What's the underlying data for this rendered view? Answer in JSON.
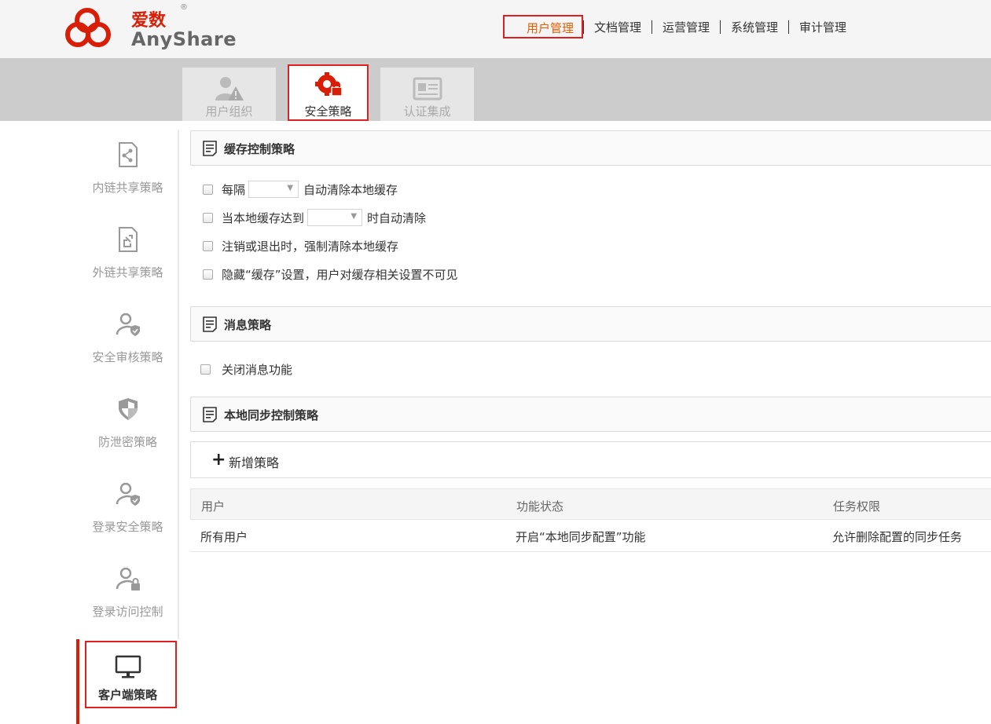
{
  "header": {
    "logo_cn": "爱数",
    "logo_reg": "®",
    "logo_en": "AnyShare",
    "nav": [
      {
        "label": "用户管理"
      },
      {
        "label": "文档管理"
      },
      {
        "label": "运营管理"
      },
      {
        "label": "系统管理"
      },
      {
        "label": "审计管理"
      }
    ],
    "brand_color": "#d81e06",
    "active_color": "#e65c00"
  },
  "subtabs": [
    {
      "label": "用户组织",
      "icon": "user-warning-icon"
    },
    {
      "label": "安全策略",
      "icon": "gear-lock-icon"
    },
    {
      "label": "认证集成",
      "icon": "id-card-icon"
    }
  ],
  "sidebar": {
    "items": [
      {
        "label": "内链共享策略",
        "icon": "internal-share-icon"
      },
      {
        "label": "外链共享策略",
        "icon": "external-share-icon"
      },
      {
        "label": "安全审核策略",
        "icon": "user-shield-icon"
      },
      {
        "label": "防泄密策略",
        "icon": "shield-icon"
      },
      {
        "label": "登录安全策略",
        "icon": "user-shield-icon"
      },
      {
        "label": "登录访问控制",
        "icon": "user-lock-icon"
      },
      {
        "label": "客户端策略",
        "icon": "monitor-icon"
      }
    ]
  },
  "cache_policy": {
    "title": "缓存控制策略",
    "opt1_prefix": "每隔",
    "opt1_select": "",
    "opt1_suffix": "自动清除本地缓存",
    "opt2_prefix": "当本地缓存达到",
    "opt2_select": "",
    "opt2_suffix": "时自动清除",
    "opt3": "注销或退出时，强制清除本地缓存",
    "opt4": "隐藏“缓存”设置，用户对缓存相关设置不可见"
  },
  "message_policy": {
    "title": "消息策略",
    "opt1": "关闭消息功能"
  },
  "sync_policy": {
    "title": "本地同步控制策略",
    "add_label": "新增策略",
    "columns": [
      "用户",
      "功能状态",
      "任务权限"
    ],
    "rows": [
      [
        "所有用户",
        "开启“本地同步配置”功能",
        "允许删除配置的同步任务"
      ]
    ]
  }
}
